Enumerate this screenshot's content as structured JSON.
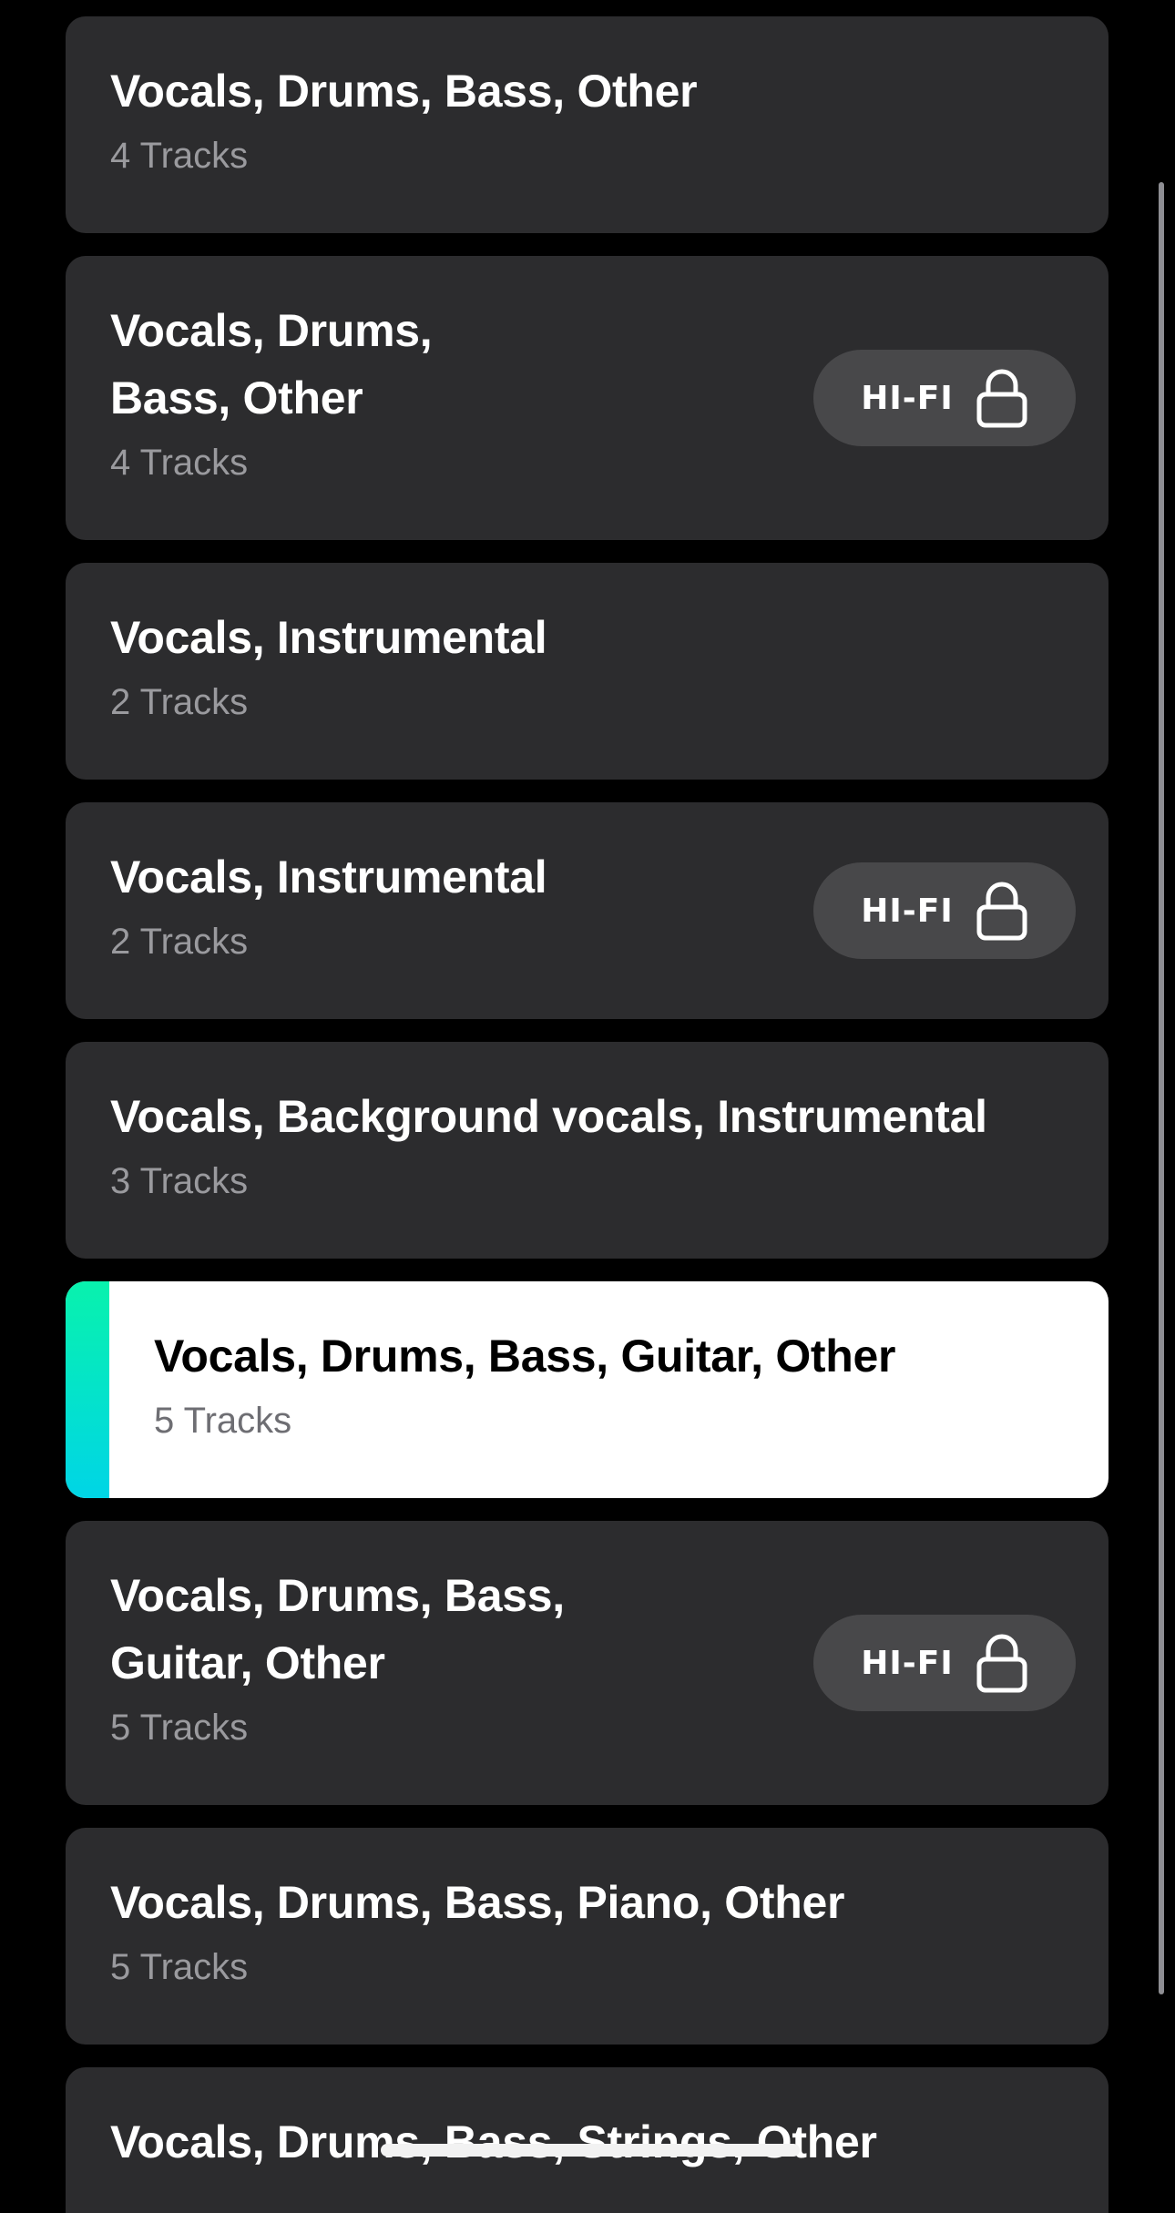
{
  "items": [
    {
      "title": "Vocals, Drums, Bass, Other",
      "tracks": "4 Tracks"
    },
    {
      "title_line1": "Vocals, Drums,",
      "title_line2": "Bass, Other",
      "tracks": "4 Tracks",
      "badge": "HI-FI",
      "badge_icon": "lock-icon"
    },
    {
      "title": "Vocals, Instrumental",
      "tracks": "2 Tracks"
    },
    {
      "title": "Vocals, Instrumental",
      "tracks": "2 Tracks",
      "badge": "HI-FI",
      "badge_icon": "lock-icon"
    },
    {
      "title": "Vocals, Background vocals, Instrumental",
      "tracks": "3 Tracks"
    },
    {
      "title": "Vocals, Drums, Bass, Guitar, Other",
      "tracks": "5 Tracks",
      "selected": true
    },
    {
      "title_line1": "Vocals, Drums, Bass,",
      "title_line2": "Guitar, Other",
      "tracks": "5 Tracks",
      "badge": "HI-FI",
      "badge_icon": "lock-icon"
    },
    {
      "title": "Vocals, Drums, Bass, Piano, Other",
      "tracks": "5 Tracks"
    },
    {
      "title": "Vocals, Drums, Bass, Strings, Other"
    }
  ],
  "colors": {
    "background": "#000000",
    "card": "#2c2c2e",
    "selected_card": "#ffffff",
    "accent_top": "#08f2ad",
    "accent_bottom": "#00d5e6",
    "badge": "#48484a"
  }
}
